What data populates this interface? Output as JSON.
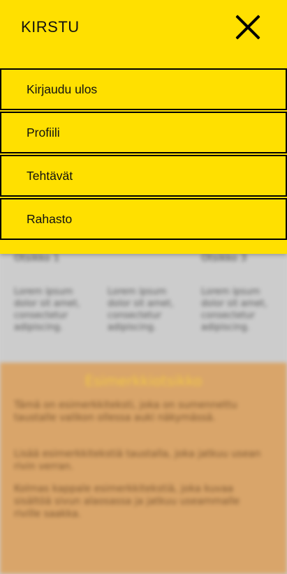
{
  "header": {
    "brand": "KIRSTU",
    "close_icon": "close-icon"
  },
  "menu": {
    "items": [
      {
        "label": "Kirjaudu ulos"
      },
      {
        "label": "Profiili"
      },
      {
        "label": "Tehtävät"
      },
      {
        "label": "Rahasto"
      }
    ]
  },
  "background": {
    "columns": [
      {
        "heading": "Otsikko 1",
        "text": "Lorem ipsum dolor sit amet, consectetur adipiscing."
      },
      {
        "heading": "",
        "text": "Lorem ipsum dolor sit amet, consectetur adipiscing."
      },
      {
        "heading": "Otsikko 3",
        "text": "Lorem ipsum dolor sit amet, consectetur adipiscing."
      }
    ],
    "section_title": "Esimerkkiotsikko",
    "paragraphs": [
      "Tämä on esimerkkiteksti, joka on sumennettu taustalle valikon ollessa auki näkymässä.",
      "Lisää esimerkkitekstiä taustalla, joka jatkuu usean rivin verran.",
      "Kolmas kappale esimerkkitekstiä, joka kuvaa sisältöä sivun alaosassa ja jatkuu useammalle riville saakka."
    ]
  }
}
